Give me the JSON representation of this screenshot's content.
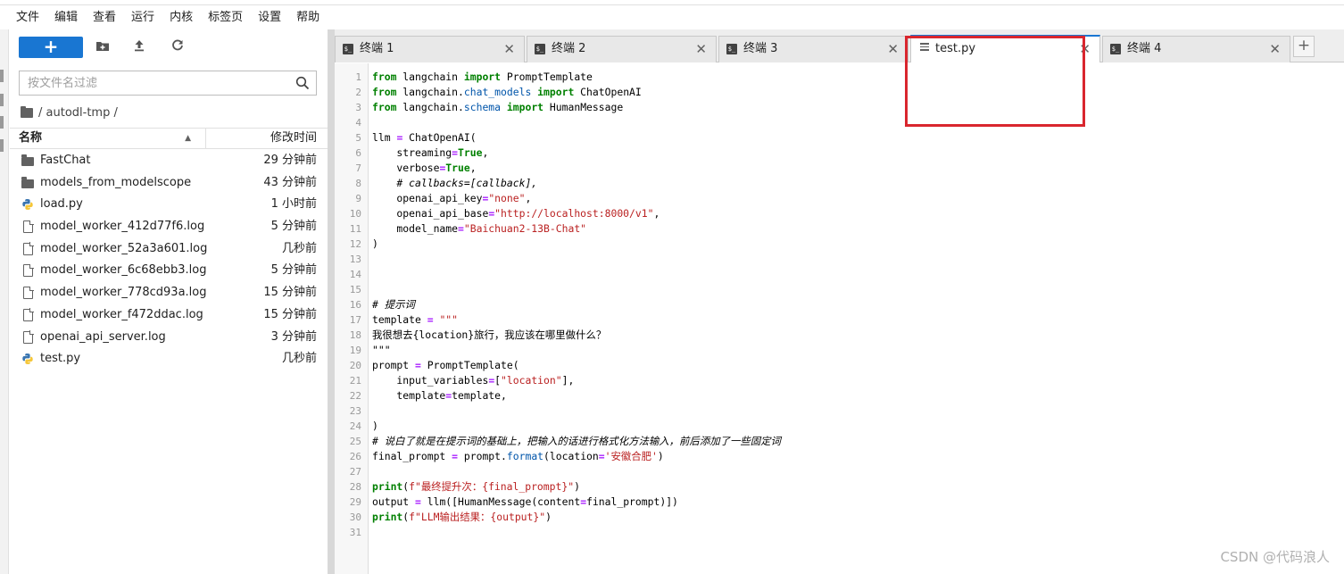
{
  "menu": [
    "文件",
    "编辑",
    "查看",
    "运行",
    "内核",
    "标签页",
    "设置",
    "帮助"
  ],
  "toolbar": {
    "new_label": "+",
    "new_folder_icon": "folder-plus-icon",
    "upload_icon": "upload-icon",
    "refresh_icon": "refresh-icon"
  },
  "search": {
    "placeholder": "按文件名过滤",
    "value": ""
  },
  "breadcrumb": "/ autodl-tmp /",
  "list_header": {
    "name": "名称",
    "modified": "修改时间"
  },
  "files": [
    {
      "name": "FastChat",
      "type": "folder",
      "time": "29 分钟前"
    },
    {
      "name": "models_from_modelscope",
      "type": "folder",
      "time": "43 分钟前"
    },
    {
      "name": "load.py",
      "type": "python",
      "time": "1 小时前"
    },
    {
      "name": "model_worker_412d77f6.log",
      "type": "file",
      "time": "5 分钟前"
    },
    {
      "name": "model_worker_52a3a601.log",
      "type": "file",
      "time": "几秒前"
    },
    {
      "name": "model_worker_6c68ebb3.log",
      "type": "file",
      "time": "5 分钟前"
    },
    {
      "name": "model_worker_778cd93a.log",
      "type": "file",
      "time": "15 分钟前"
    },
    {
      "name": "model_worker_f472ddac.log",
      "type": "file",
      "time": "15 分钟前"
    },
    {
      "name": "openai_api_server.log",
      "type": "file",
      "time": "3 分钟前"
    },
    {
      "name": "test.py",
      "type": "python",
      "time": "几秒前"
    }
  ],
  "tabs": [
    {
      "label": "终端 1",
      "icon": "terminal-icon",
      "active": false
    },
    {
      "label": "终端 2",
      "icon": "terminal-icon",
      "active": false
    },
    {
      "label": "终端 3",
      "icon": "terminal-icon",
      "active": false
    },
    {
      "label": "test.py",
      "icon": "text-file-icon",
      "active": true
    },
    {
      "label": "终端 4",
      "icon": "terminal-icon",
      "active": false
    }
  ],
  "tab_add_label": "+",
  "code_line_numbers": [
    "1",
    "2",
    "3",
    "4",
    "5",
    "6",
    "7",
    "8",
    "9",
    "10",
    "11",
    "12",
    "13",
    "14",
    "15",
    "16",
    "17",
    "18",
    "19",
    "20",
    "21",
    "22",
    "23",
    "24",
    "25",
    "26",
    "27",
    "28",
    "29",
    "30",
    "31"
  ],
  "code": {
    "l1": "from langchain import PromptTemplate",
    "l2": "from langchain.chat_models import ChatOpenAI",
    "l3": "from langchain.schema import HumanMessage",
    "l5": "llm = ChatOpenAI(",
    "l6": "    streaming=True,",
    "l7": "    verbose=True,",
    "l8": "    # callbacks=[callback],",
    "l9": "    openai_api_key=\"none\",",
    "l10": "    openai_api_base=\"http://localhost:8000/v1\",",
    "l11": "    model_name=\"Baichuan2-13B-Chat\"",
    "l12": ")",
    "l16": "# 提示词",
    "l17": "template = \"\"\"",
    "l18": "我很想去{location}旅行，我应该在哪里做什么？",
    "l19": "\"\"\"",
    "l20": "prompt = PromptTemplate(",
    "l21": "    input_variables=[\"location\"],",
    "l22": "    template=template,",
    "l24": ")",
    "l25": "# 说白了就是在提示词的基础上，把输入的话进行格式化方法输入，前后添加了一些固定词",
    "l26": "final_prompt = prompt.format(location='安徽合肥')",
    "l28": "print(f\"最终提升次：{final_prompt}\")",
    "l29": "output = llm([HumanMessage(content=final_prompt)])",
    "l30": "print(f\"LLM输出结果：{output}\")"
  },
  "watermark": "CSDN @代码浪人",
  "colors": {
    "accent": "#1976d2",
    "highlight_box": "#d9262e"
  }
}
